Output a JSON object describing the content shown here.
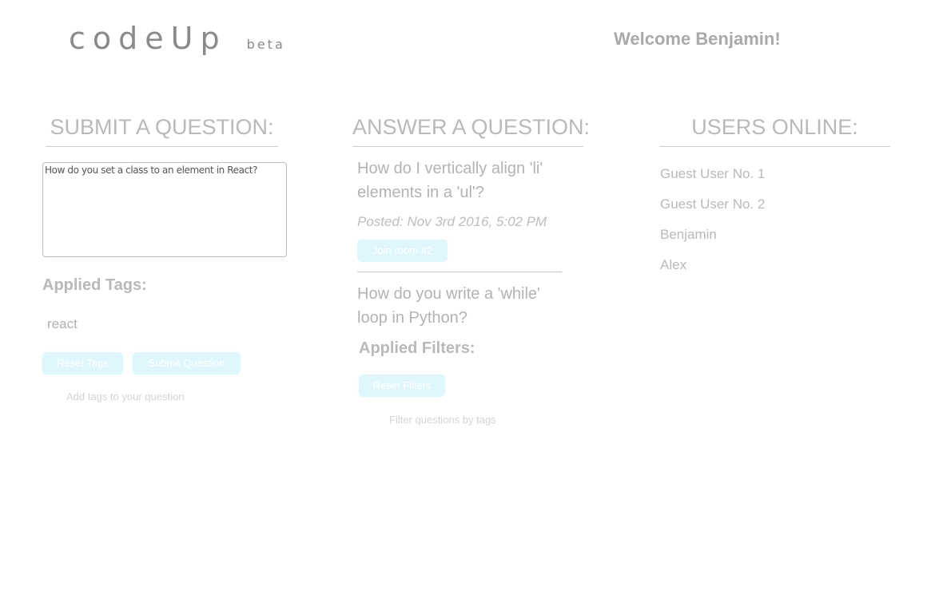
{
  "header": {
    "logo": "codeUp",
    "logo_badge": "beta",
    "welcome": "Welcome Benjamin!"
  },
  "submit": {
    "title": "SUBMIT A QUESTION:",
    "question_value": "How do you set a class to an element in React?",
    "tags_heading": "Applied Tags:",
    "tags": [
      "react"
    ],
    "reset_tags_label": "Reset Tags",
    "submit_label": "Submit Question",
    "tag_placeholder": "Add tags to your question"
  },
  "answer": {
    "title": "ANSWER A QUESTION:",
    "questions": [
      {
        "title": "How do I vertically align 'li' elements in a 'ul'?",
        "posted": "Posted: Nov 3rd 2016, 5:02 PM",
        "join_label": "Join room #2"
      },
      {
        "title": "How do you write a 'while' loop in Python?"
      }
    ],
    "filters_heading": "Applied Filters:",
    "reset_filters_label": "Reset Filters",
    "filter_placeholder": "Filter questions by tags"
  },
  "users": {
    "title": "USERS ONLINE:",
    "list": [
      "Guest User No. 1",
      "Guest User No. 2",
      "Benjamin",
      "Alex"
    ]
  },
  "colors": {
    "button_bg": "#dff7fc",
    "heading": "#b9b9b9",
    "logo": "#8a8a8a"
  }
}
